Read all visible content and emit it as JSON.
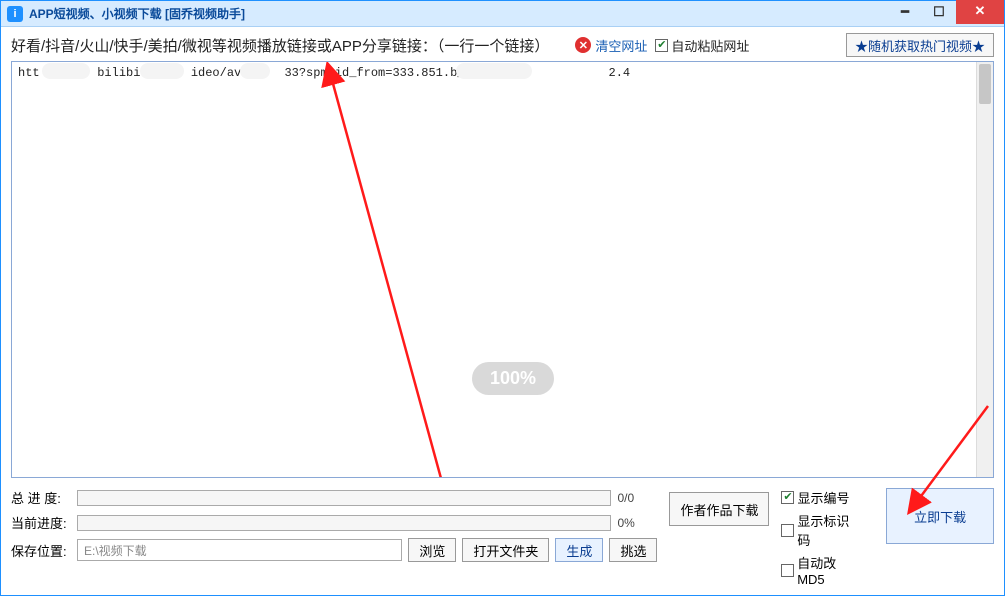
{
  "window": {
    "title": "APP短视频、小视频下载 [固乔视频助手]"
  },
  "toolbar": {
    "instruction": "好看/抖音/火山/快手/美拍/微视等视频播放链接或APP分享链接：（一行一个链接）",
    "clear_label": "清空网址",
    "auto_paste_label": "自动粘贴网址",
    "auto_paste_checked": true,
    "random_btn": "★随机获取热门视频★"
  },
  "url_input": {
    "value": "htt        bilibi       ideo/av818   33?spm_id_from=333.851.b_7265706f7           2.4\n"
  },
  "watermark": "100%",
  "progress": {
    "total_label": "总 进 度:",
    "total_text": "0/0",
    "current_label": "当前进度:",
    "current_text": "0%"
  },
  "save": {
    "label": "保存位置:",
    "path": "E:\\视频下载",
    "browse_btn": "浏览",
    "open_folder_btn": "打开文件夹",
    "gen_btn": "生成",
    "pick_btn": "挑选"
  },
  "mid": {
    "author_works_btn": "作者作品下载"
  },
  "options": {
    "show_number": {
      "label": "显示编号",
      "checked": true
    },
    "show_marker": {
      "label": "显示标识码",
      "checked": false
    },
    "auto_md5": {
      "label": "自动改MD5",
      "checked": false
    }
  },
  "download_btn": "立即下载"
}
